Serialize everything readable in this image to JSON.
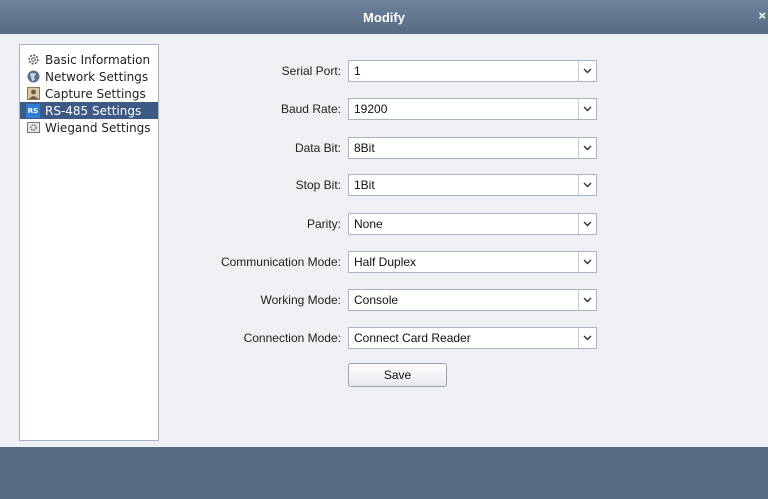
{
  "window": {
    "title": "Modify",
    "close_glyph": "×"
  },
  "sidebar": {
    "items": [
      {
        "label": "Basic Information",
        "icon": "gear-icon",
        "selected": false
      },
      {
        "label": "Network Settings",
        "icon": "globe-icon",
        "selected": false
      },
      {
        "label": "Capture Settings",
        "icon": "person-icon",
        "selected": false
      },
      {
        "label": "RS-485 Settings",
        "icon": "rs-icon",
        "icon_text": "RS",
        "selected": true
      },
      {
        "label": "Wiegand Settings",
        "icon": "wiegand-icon",
        "selected": false
      }
    ]
  },
  "form": {
    "serial_port": {
      "label": "Serial Port:",
      "value": "1"
    },
    "baud_rate": {
      "label": "Baud Rate:",
      "value": "19200"
    },
    "data_bit": {
      "label": "Data Bit:",
      "value": "8Bit"
    },
    "stop_bit": {
      "label": "Stop Bit:",
      "value": "1Bit"
    },
    "parity": {
      "label": "Parity:",
      "value": "None"
    },
    "communication_mode": {
      "label": "Communication Mode:",
      "value": "Half Duplex"
    },
    "working_mode": {
      "label": "Working Mode:",
      "value": "Console"
    },
    "connection_mode": {
      "label": "Connection Mode:",
      "value": "Connect Card Reader"
    },
    "save_label": "Save"
  },
  "colors": {
    "titlebar": "#5f7490",
    "selected": "#3d5a86",
    "footer": "#566b84"
  }
}
